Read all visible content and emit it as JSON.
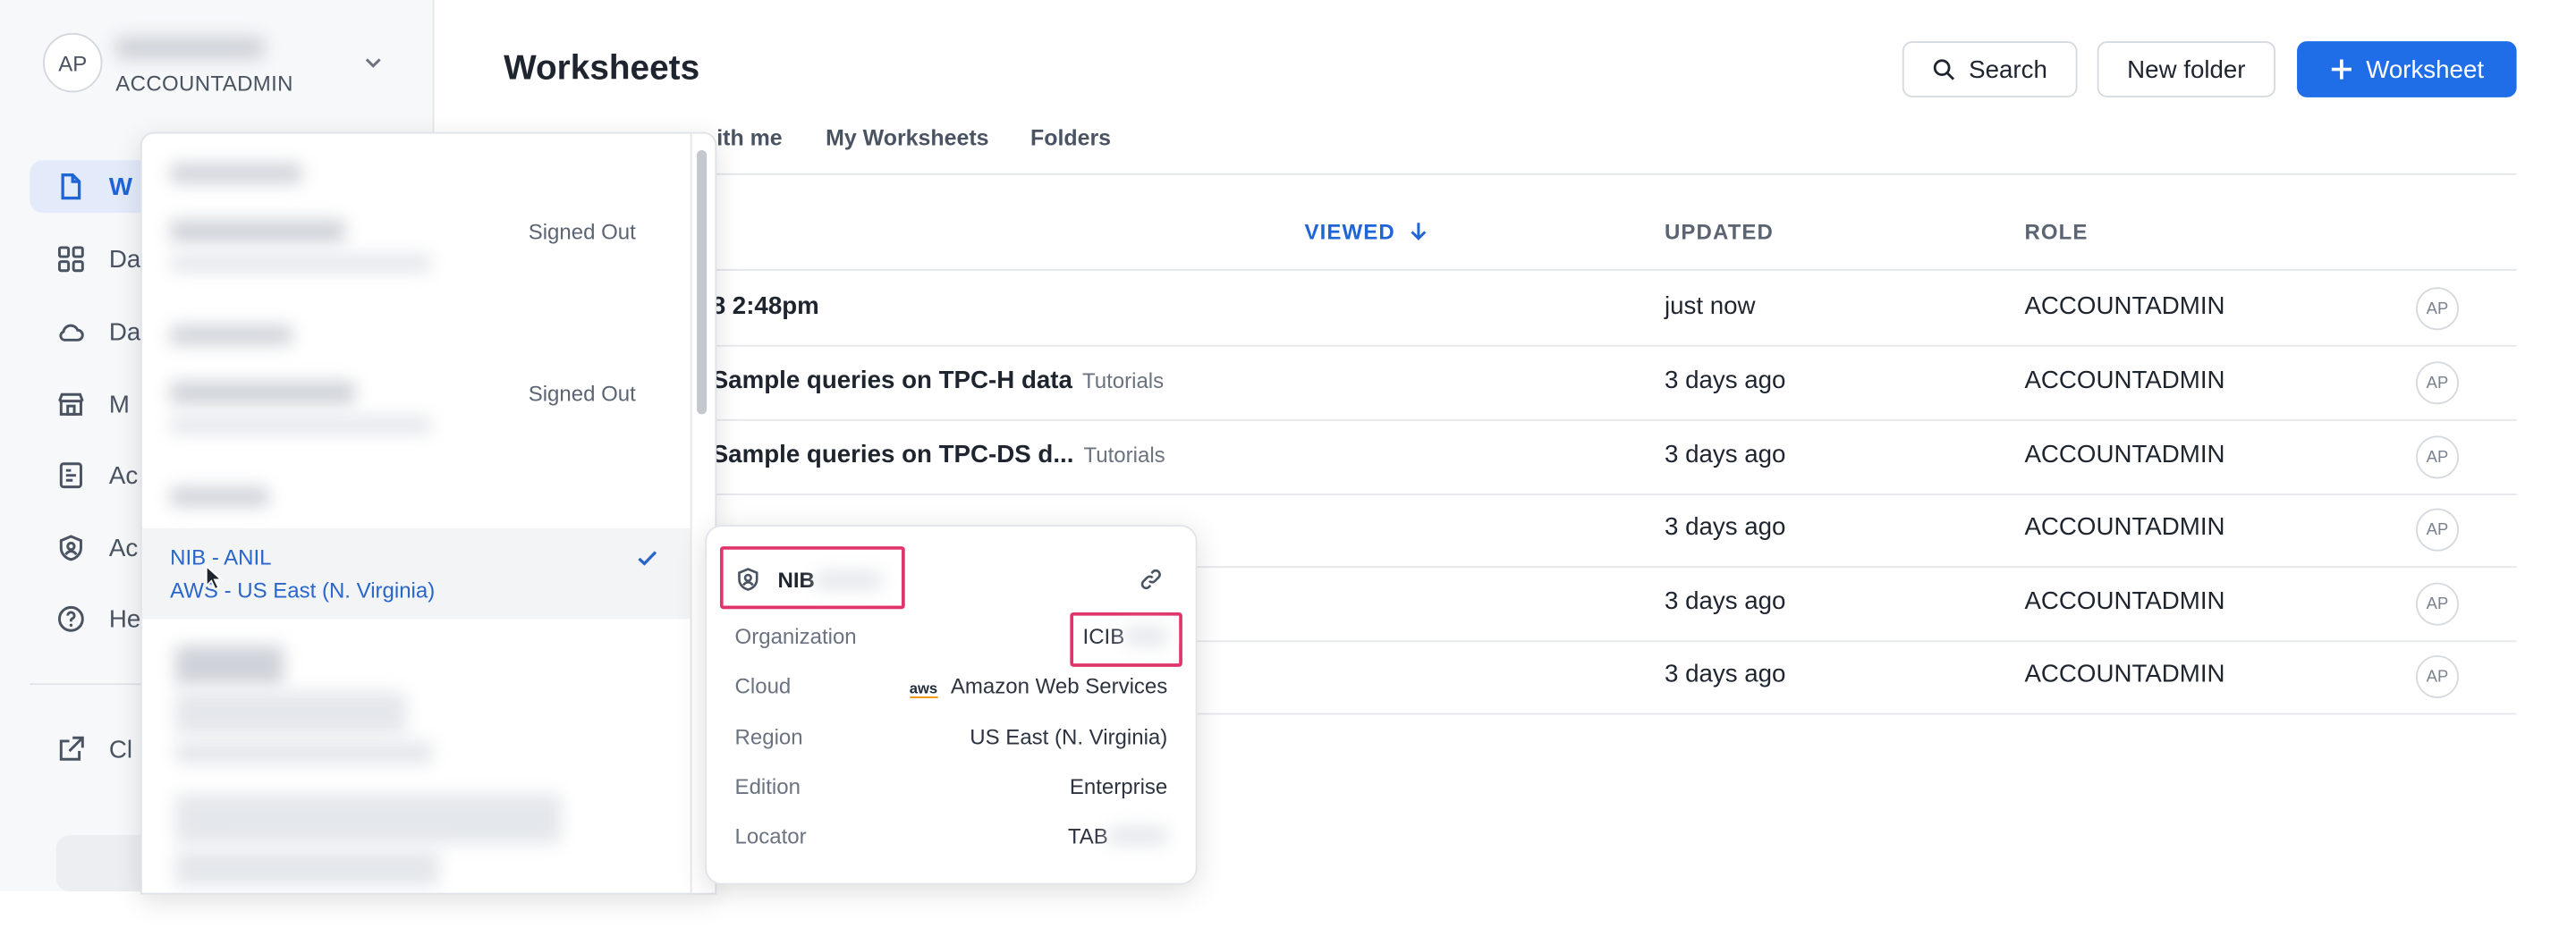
{
  "account": {
    "initials": "AP",
    "role": "ACCOUNTADMIN"
  },
  "sidebar": {
    "items": [
      {
        "label": "W",
        "icon": "document-icon",
        "active": true
      },
      {
        "label": "Da",
        "icon": "grid-icon"
      },
      {
        "label": "Da",
        "icon": "cloud-icon"
      },
      {
        "label": "M",
        "icon": "store-icon"
      },
      {
        "label": "Ac",
        "icon": "list-icon"
      },
      {
        "label": "Ac",
        "icon": "shield-user-icon"
      },
      {
        "label": "He",
        "icon": "help-icon"
      },
      {
        "label": "Cl",
        "icon": "external-link-icon"
      }
    ]
  },
  "header": {
    "title": "Worksheets",
    "search_label": "Search",
    "new_folder_label": "New folder",
    "new_worksheet_label": "Worksheet"
  },
  "tabs": [
    "ith me",
    "My Worksheets",
    "Folders"
  ],
  "table": {
    "headers": {
      "viewed": "VIEWED",
      "updated": "UPDATED",
      "role": "ROLE"
    },
    "rows": [
      {
        "name": "8 2:48pm",
        "tag": "",
        "updated": "just now",
        "role": "ACCOUNTADMIN",
        "owner": "AP"
      },
      {
        "name": "Sample queries on TPC-H data",
        "tag": "Tutorials",
        "updated": "3 days ago",
        "role": "ACCOUNTADMIN",
        "owner": "AP"
      },
      {
        "name": "Sample queries on TPC-DS d...",
        "tag": "Tutorials",
        "updated": "3 days ago",
        "role": "ACCOUNTADMIN",
        "owner": "AP"
      },
      {
        "name": "",
        "tag": "",
        "updated": "3 days ago",
        "role": "ACCOUNTADMIN",
        "owner": "AP"
      },
      {
        "name": "",
        "tag": "",
        "updated": "3 days ago",
        "role": "ACCOUNTADMIN",
        "owner": "AP"
      },
      {
        "name": "",
        "tag": "",
        "updated": "3 days ago",
        "role": "ACCOUNTADMIN",
        "owner": "AP"
      }
    ]
  },
  "account_menu": {
    "signed_out_label": "Signed Out",
    "selected": {
      "line1": "NIB - ANIL",
      "line2": "AWS - US East (N. Virginia)"
    }
  },
  "account_card": {
    "name": "NIB",
    "fields": [
      {
        "key": "Organization",
        "value": "ICIB"
      },
      {
        "key": "Cloud",
        "value": "Amazon Web Services"
      },
      {
        "key": "Region",
        "value": "US East (N. Virginia)"
      },
      {
        "key": "Edition",
        "value": "Enterprise"
      },
      {
        "key": "Locator",
        "value": "TAB"
      }
    ],
    "aws_badge": "aws"
  },
  "colors": {
    "accent": "#1f6ee8",
    "highlight": "#e0356b",
    "selected_text": "#2a66c9"
  }
}
